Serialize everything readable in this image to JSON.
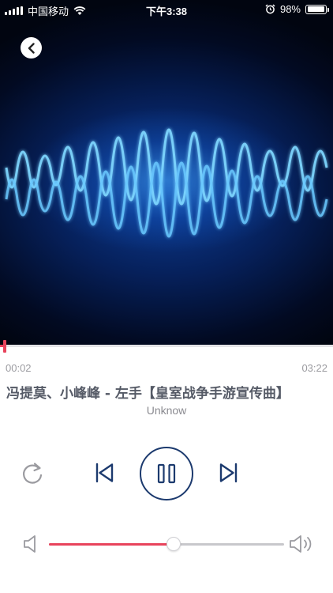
{
  "status_bar": {
    "carrier": "中国移动",
    "time": "下午3:38",
    "battery_percent": "98%",
    "battery_level": 0.98,
    "icons": [
      "signal-icon",
      "wifi-icon",
      "alarm-icon",
      "battery-icon"
    ]
  },
  "player": {
    "current_time": "00:02",
    "total_time": "03:22",
    "progress": 0.01,
    "song_title": "冯提莫、小峰峰 - 左手【皇室战争手游宣传曲】",
    "artist": "Unknow",
    "volume": 0.53,
    "is_playing": true
  },
  "controls": {
    "back_icon": "chevron-left-icon",
    "repeat_icon": "repeat-icon",
    "previous_icon": "skip-previous-icon",
    "pause_icon": "pause-icon",
    "next_icon": "skip-next-icon",
    "volume_low_icon": "volume-low-icon",
    "volume_high_icon": "volume-high-icon"
  },
  "colors": {
    "accent": "#e8435c",
    "control_navy": "#1c3a6e",
    "control_gray": "#9b9ba0"
  }
}
